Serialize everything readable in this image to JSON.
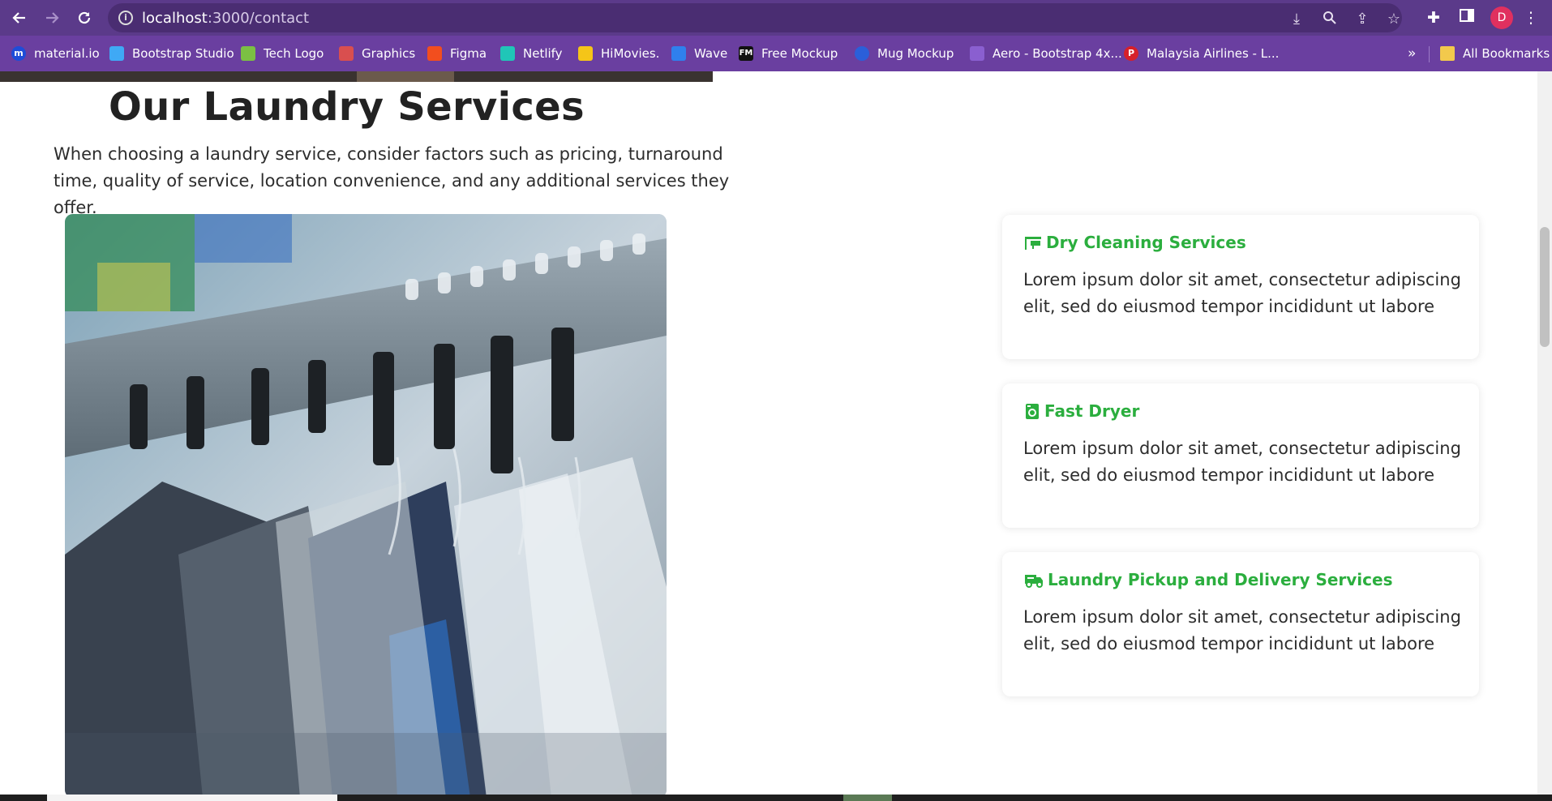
{
  "browser": {
    "url_host": "localhost",
    "url_path": ":3000/contact",
    "avatar_letter": "D",
    "bookmarks": [
      {
        "label": "material.io",
        "color": "#1e4dd8",
        "glyph": "m"
      },
      {
        "label": "Bootstrap Studio",
        "color": "#3fa9f5",
        "glyph": ""
      },
      {
        "label": "Tech Logo",
        "color": "#7bc043",
        "glyph": ""
      },
      {
        "label": "Graphics",
        "color": "#d94f4f",
        "glyph": ""
      },
      {
        "label": "Figma",
        "color": "#f24e1e",
        "glyph": ""
      },
      {
        "label": "Netlify",
        "color": "#20c6b7",
        "glyph": ""
      },
      {
        "label": "HiMovies.",
        "color": "#f5c518",
        "glyph": ""
      },
      {
        "label": "Wave",
        "color": "#2f80ed",
        "glyph": ""
      },
      {
        "label": "Free Mockup",
        "color": "#111111",
        "glyph": "FM"
      },
      {
        "label": "Mug Mockup",
        "color": "#2b5fd9",
        "glyph": ""
      },
      {
        "label": "Aero - Bootstrap 4x...",
        "color": "#8a5fd0",
        "glyph": ""
      },
      {
        "label": "Malaysia Airlines - L...",
        "color": "#d6202a",
        "glyph": "P"
      }
    ],
    "all_bookmarks_label": "All Bookmarks",
    "more_label": "»"
  },
  "page": {
    "heading": "Our Laundry Services",
    "intro": "When choosing a laundry service, consider factors such as pricing, turnaround time, quality of service, location convenience, and any additional services they offer.",
    "accent_color": "#2bae3e",
    "services": [
      {
        "icon": "dry-cleaning-icon",
        "title": "Dry Cleaning Services",
        "text": "Lorem ipsum dolor sit amet, consectetur adipiscing elit, sed do eiusmod tempor incididunt ut labore"
      },
      {
        "icon": "dryer-icon",
        "title": "Fast Dryer",
        "text": "Lorem ipsum dolor sit amet, consectetur adipiscing elit, sed do eiusmod tempor incididunt ut labore"
      },
      {
        "icon": "delivery-truck-icon",
        "title": "Laundry Pickup and Delivery Services",
        "text": "Lorem ipsum dolor sit amet, consectetur adipiscing elit, sed do eiusmod tempor incididunt ut labore"
      }
    ]
  }
}
